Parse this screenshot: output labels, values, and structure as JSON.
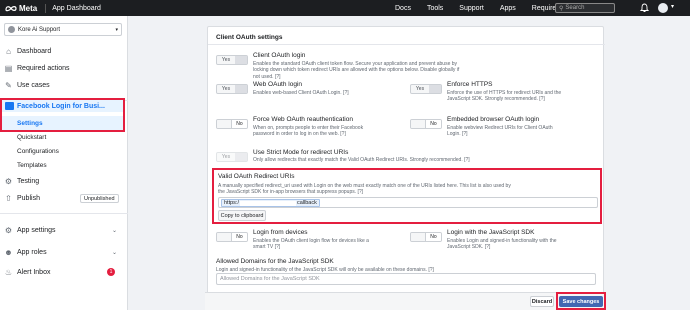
{
  "topbar": {
    "brand": "Meta",
    "app_dashboard": "App Dashboard",
    "nav": [
      "Docs",
      "Tools",
      "Support",
      "Apps",
      "Required actions"
    ],
    "search_placeholder": "Search"
  },
  "sidebar": {
    "app_name": "Kore Ai Support",
    "items": {
      "dashboard": "Dashboard",
      "required_actions": "Required actions",
      "use_cases": "Use cases",
      "fb_login": "Facebook Login for Busi...",
      "settings": "Settings",
      "quickstart": "Quickstart",
      "configurations": "Configurations",
      "templates": "Templates",
      "testing": "Testing",
      "publish": "Publish",
      "unpublished": "Unpublished",
      "app_settings": "App settings",
      "app_roles": "App roles",
      "alert_inbox": "Alert Inbox",
      "alert_count": "1"
    }
  },
  "panel": {
    "title": "Client OAuth settings",
    "options": [
      {
        "key": "client_oauth",
        "title": "Client OAuth login",
        "state": "Yes",
        "desc": "Enables the standard OAuth client token flow. Secure your application and prevent abuse by locking down which token redirect URIs are allowed with the options below. Disable globally if not used. [?]"
      },
      {
        "key": "web_oauth",
        "title": "Web OAuth login",
        "state": "Yes",
        "desc": "Enables web-based Client OAuth Login. [?]"
      },
      {
        "key": "enforce_https",
        "title": "Enforce HTTPS",
        "state": "Yes",
        "desc": "Enforce the use of HTTPS for redirect URIs and the JavaScript SDK. Strongly recommended. [?]"
      },
      {
        "key": "force_reauth",
        "title": "Force Web OAuth reauthentication",
        "state": "No",
        "desc": "When on, prompts people to enter their Facebook password in order to log in on the web. [?]"
      },
      {
        "key": "embedded_browser",
        "title": "Embedded browser OAuth login",
        "state": "No",
        "desc": "Enable webview Redirect URIs for Client OAuth Login. [?]"
      },
      {
        "key": "strict_mode",
        "title": "Use Strict Mode for redirect URIs",
        "state": "Yes",
        "desc": "Only allow redirects that exactly match the Valid OAuth Redirect URIs. Strongly recommended. [?]"
      },
      {
        "key": "login_devices",
        "title": "Login from devices",
        "state": "No",
        "desc": "Enables the OAuth client login flow for devices like a smart TV [?]"
      },
      {
        "key": "login_js_sdk",
        "title": "Login with the JavaScript SDK",
        "state": "No",
        "desc": "Enables Login and signed-in functionality with the JavaScript SDK. [?]"
      }
    ],
    "redirect": {
      "title": "Valid OAuth Redirect URIs",
      "desc": "A manually specified redirect_uri used with Login on the web must exactly match one of the URIs listed here. This list is also used by the JavaScript SDK for in-app browsers that suppress popups. [?]",
      "uri_prefix": "https:/",
      "uri_suffix": "callback",
      "copy_label": "Copy to clipboard"
    },
    "domains": {
      "title": "Allowed Domains for the JavaScript SDK",
      "desc": "Login and signed-in functionality of the JavaScript SDK will only be available on these domains. [?]",
      "placeholder": "Allowed Domains for the JavaScript SDK"
    }
  },
  "footer": {
    "discard": "Discard",
    "save": "Save changes"
  },
  "colors": {
    "highlight": "#e41e3f",
    "accent": "#1877f2",
    "save_button": "#4267b2",
    "topbar": "#1c1e21"
  }
}
